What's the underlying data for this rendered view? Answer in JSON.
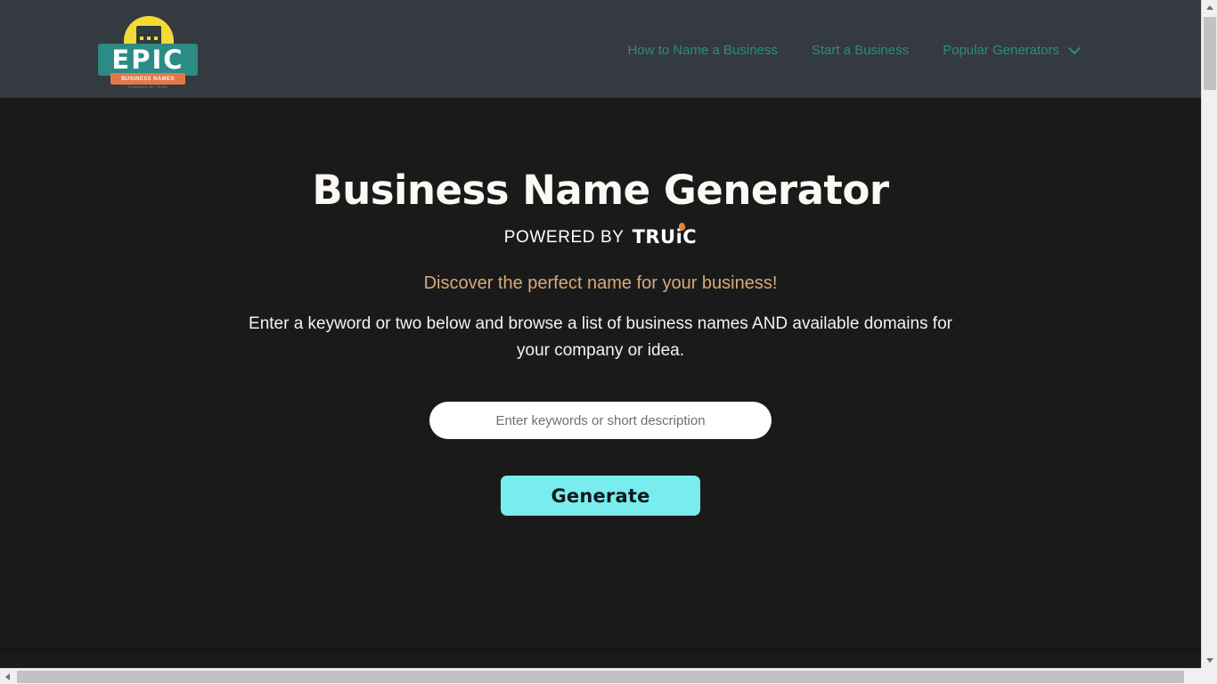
{
  "header": {
    "logo": {
      "name": "EPIC",
      "banner": "BUSINESS NAMES",
      "subtitle": "POWERED BY TRUiC",
      "dome_color": "#f5d935",
      "epic_box_color": "#2c8b85",
      "banner_color": "#e2784a"
    },
    "nav": [
      {
        "label": "How to Name a Business",
        "has_chevron": false
      },
      {
        "label": "Start a Business",
        "has_chevron": false
      },
      {
        "label": "Popular Generators",
        "has_chevron": true
      }
    ],
    "nav_color": "#2e8b7d",
    "background": "#343a40"
  },
  "hero": {
    "title": "Business Name Generator",
    "powered_by_prefix": "POWERED BY",
    "powered_by_brand": "TRUiC",
    "tagline": "Discover the perfect name for your business!",
    "intro": "Enter a keyword or two below and browse a list of business names AND available domains for your company or idea.",
    "tagline_color": "#d9a978",
    "background": "#1a1a1a"
  },
  "search": {
    "value": "",
    "placeholder": "Enter keywords or short description"
  },
  "actions": {
    "generate_label": "Generate",
    "generate_color": "#78ecee"
  },
  "scrollbars": {
    "vertical_icon_up": "arrow-up-icon",
    "vertical_icon_down": "arrow-down-icon",
    "horizontal_icon_left": "arrow-left-icon",
    "horizontal_icon_right": "arrow-right-icon"
  }
}
